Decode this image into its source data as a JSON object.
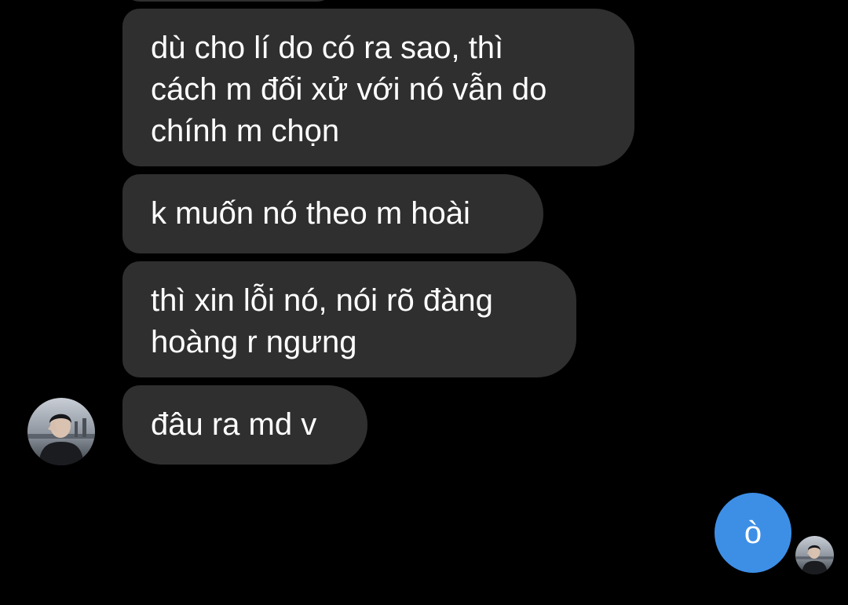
{
  "colors": {
    "background": "#000000",
    "incoming_bubble": "#2f2f2f",
    "outgoing_bubble": "#3d8fe6",
    "text": "#ffffff"
  },
  "messages": [
    {
      "direction": "incoming",
      "lines": [
        "dù cho lí do có ra sao, thì",
        "cách m đối xử với nó vẫn do",
        "chính m chọn"
      ]
    },
    {
      "direction": "incoming",
      "lines": [
        "k muốn nó theo m hoài"
      ]
    },
    {
      "direction": "incoming",
      "lines": [
        "thì xin lỗi nó, nói rõ đàng",
        "hoàng r ngưng"
      ]
    },
    {
      "direction": "incoming",
      "lines": [
        "đâu ra md v"
      ]
    },
    {
      "direction": "outgoing",
      "lines": [
        "ò"
      ]
    }
  ],
  "icons": {
    "contact_avatar": "contact-avatar-photo",
    "read_receipt_avatar": "read-receipt-avatar-photo"
  }
}
